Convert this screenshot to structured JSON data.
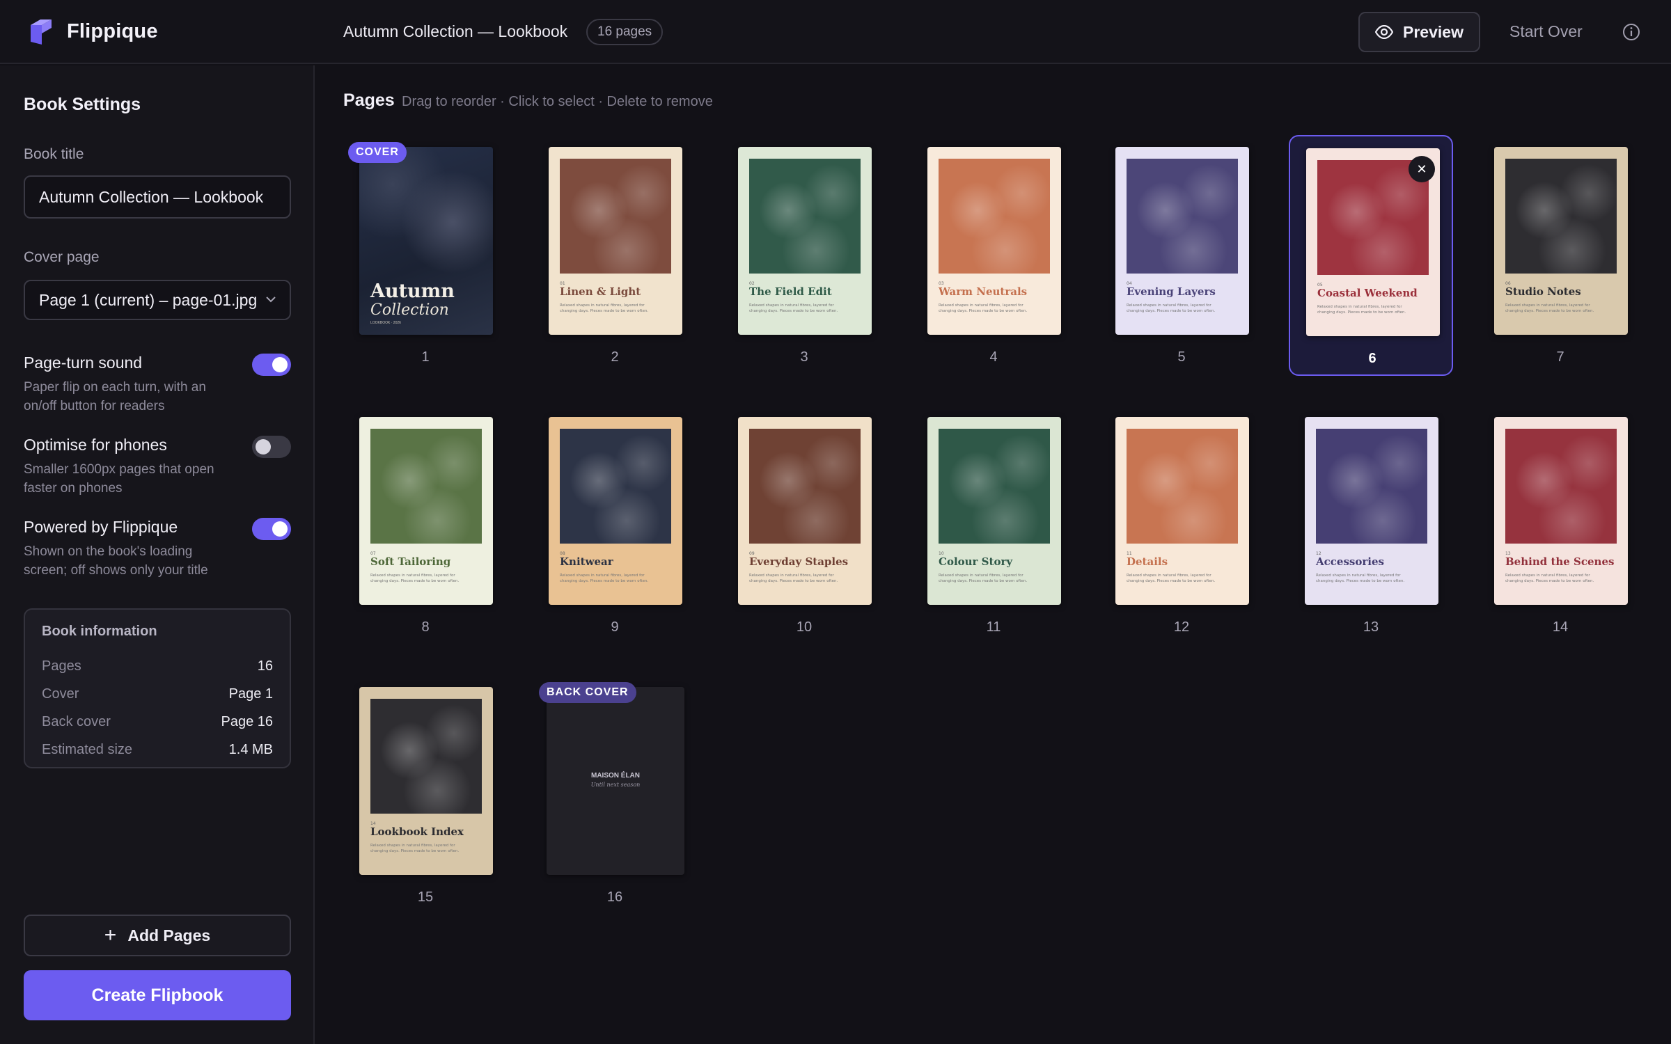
{
  "app": {
    "name": "Flippique"
  },
  "header": {
    "book_title": "Autumn Collection — Lookbook",
    "pages_badge": "16 pages",
    "preview_label": "Preview",
    "start_over_label": "Start Over"
  },
  "sidebar": {
    "heading": "Book Settings",
    "book_title_label": "Book title",
    "book_title_value": "Autumn Collection — Lookbook",
    "cover_label": "Cover page",
    "cover_value": "Page 1 (current) – page-01.jpg",
    "toggles": [
      {
        "title": "Page-turn sound",
        "desc": "Paper flip on each turn, with an on/off button for readers",
        "on": true
      },
      {
        "title": "Optimise for phones",
        "desc": "Smaller 1600px pages that open faster on phones",
        "on": false
      },
      {
        "title": "Powered by Flippique",
        "desc": "Shown on the book's loading screen; off shows only your title",
        "on": true
      }
    ],
    "info": {
      "heading": "Book information",
      "rows": [
        {
          "k": "Pages",
          "v": "16"
        },
        {
          "k": "Cover",
          "v": "Page 1"
        },
        {
          "k": "Back cover",
          "v": "Page 16"
        },
        {
          "k": "Estimated size",
          "v": "1.4 MB"
        }
      ]
    },
    "add_pages_label": "Add Pages",
    "create_label": "Create Flipbook"
  },
  "main": {
    "title": "Pages",
    "hint": "Drag to reorder · Click to select · Delete to remove",
    "selected_page": 6,
    "page_body_text": "Relaxed shapes in natural fibres, layered for changing days. Pieces made to be worn often.",
    "cover": {
      "badge": "COVER",
      "title1": "Autumn",
      "title2": "Collection",
      "small": "LOOKBOOK · 2026"
    },
    "back_cover": {
      "badge": "BACK COVER",
      "brand": "MAISON ÉLAN",
      "tagline": "Until next season"
    },
    "pages": [
      {
        "num": "1"
      },
      {
        "num": "2",
        "idx": "01",
        "title": "Linen & Light",
        "bg": "#f1e3cd",
        "accent": "#7a4a3c",
        "photo": "#7e4c3e"
      },
      {
        "num": "3",
        "idx": "02",
        "title": "The Field Edit",
        "bg": "#dde8d6",
        "accent": "#2f5a48",
        "photo": "#315a4a"
      },
      {
        "num": "4",
        "idx": "03",
        "title": "Warm Neutrals",
        "bg": "#f8eadb",
        "accent": "#c4704e",
        "photo": "#c87552"
      },
      {
        "num": "5",
        "idx": "04",
        "title": "Evening Layers",
        "bg": "#e5e1f4",
        "accent": "#4a4378",
        "photo": "#4c4678"
      },
      {
        "num": "6",
        "idx": "05",
        "title": "Coastal Weekend",
        "bg": "#f6e4df",
        "accent": "#9a2f3a",
        "photo": "#9e3440"
      },
      {
        "num": "7",
        "idx": "06",
        "title": "Studio Notes",
        "bg": "#d9c9ad",
        "accent": "#2c2c30",
        "photo": "#2e2d31"
      },
      {
        "num": "8",
        "idx": "07",
        "title": "Soft Tailoring",
        "bg": "#eef0e0",
        "accent": "#4d6738",
        "photo": "#5a7446"
      },
      {
        "num": "9",
        "idx": "08",
        "title": "Knitwear",
        "bg": "#e9c293",
        "accent": "#2b3142",
        "photo": "#2d3447"
      },
      {
        "num": "10",
        "idx": "09",
        "title": "Everyday Staples",
        "bg": "#f1e0c8",
        "accent": "#6e3f33",
        "photo": "#6f4234"
      },
      {
        "num": "11",
        "idx": "10",
        "title": "Colour Story",
        "bg": "#dbe6d3",
        "accent": "#2f5848",
        "photo": "#2f5848"
      },
      {
        "num": "12",
        "idx": "11",
        "title": "Details",
        "bg": "#f8e8d8",
        "accent": "#c4704e",
        "photo": "#c87552"
      },
      {
        "num": "13",
        "idx": "12",
        "title": "Accessories",
        "bg": "#e6e1f2",
        "accent": "#433c70",
        "photo": "#463f73"
      },
      {
        "num": "14",
        "idx": "13",
        "title": "Behind the Scenes",
        "bg": "#f5e3de",
        "accent": "#92303b",
        "photo": "#96333e"
      },
      {
        "num": "15",
        "idx": "14",
        "title": "Lookbook Index",
        "bg": "#d7c6a8",
        "accent": "#2c2c30",
        "photo": "#2e2d31"
      },
      {
        "num": "16"
      }
    ]
  }
}
